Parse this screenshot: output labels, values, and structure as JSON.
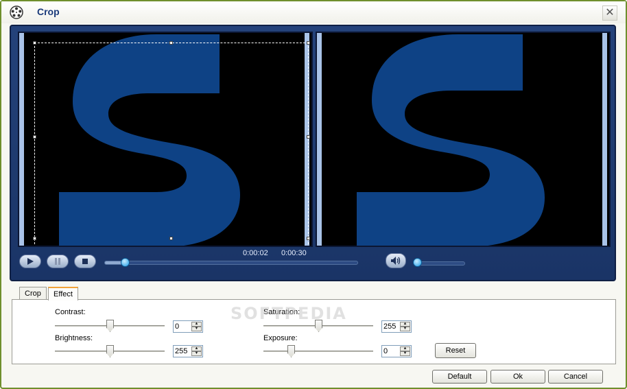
{
  "window": {
    "title": "Crop",
    "close_label": "✕"
  },
  "preview": {
    "time_current": "0:00:02",
    "time_total": "0:00:30",
    "seek_progress": 0.08,
    "volume_level": 0.0
  },
  "tabs": [
    {
      "label": "Crop",
      "active": false
    },
    {
      "label": "Effect",
      "active": true
    }
  ],
  "effect": {
    "contrast": {
      "label": "Contrast:",
      "value": "0",
      "level": 0.5
    },
    "brightness": {
      "label": "Brightness:",
      "value": "255",
      "level": 0.5
    },
    "saturation": {
      "label": "Saturation:",
      "value": "255",
      "level": 0.5
    },
    "exposure": {
      "label": "Exposure:",
      "value": "0",
      "level": 0.25
    },
    "reset_label": "Reset"
  },
  "watermark": "SOFTPEDIA",
  "buttons": {
    "default": "Default",
    "ok": "Ok",
    "cancel": "Cancel"
  },
  "colors": {
    "panel": "#1f3a70",
    "logo": "#0e4285",
    "accent_tab": "#f2a33a",
    "frame": "#6f8f2d"
  }
}
